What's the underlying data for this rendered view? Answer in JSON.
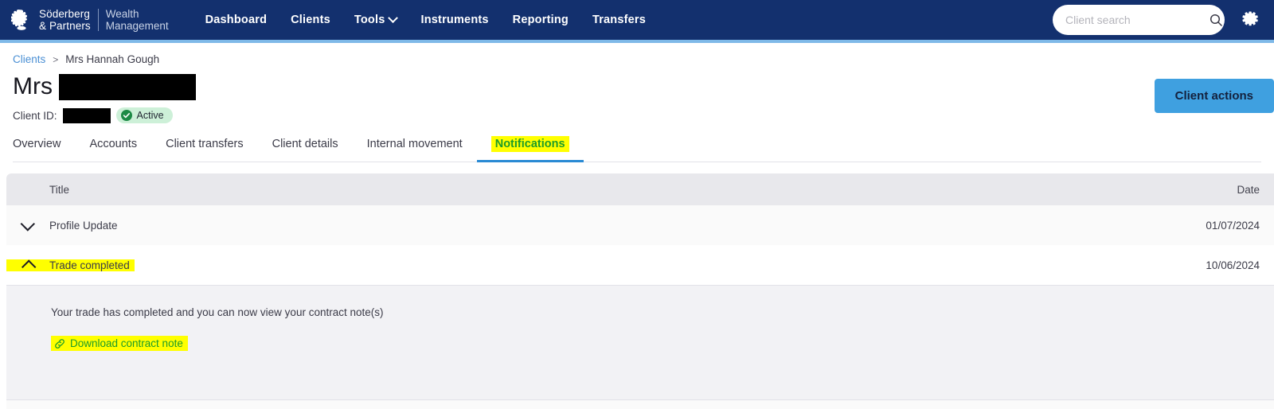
{
  "header": {
    "brand_name": "Söderberg\n& Partners",
    "brand_sub": "Wealth\nManagement",
    "nav": [
      {
        "label": "Dashboard",
        "has_caret": false
      },
      {
        "label": "Clients",
        "has_caret": false
      },
      {
        "label": "Tools",
        "has_caret": true
      },
      {
        "label": "Instruments",
        "has_caret": false
      },
      {
        "label": "Reporting",
        "has_caret": false
      },
      {
        "label": "Transfers",
        "has_caret": false
      }
    ],
    "search": {
      "placeholder": "Client search",
      "value": "",
      "icon": "search-icon"
    },
    "settings_icon": "gear-icon",
    "colors": {
      "navy": "#13306e",
      "underline": "#7fb9e8"
    }
  },
  "breadcrumb": {
    "root_label": "Clients",
    "separator": ">",
    "current_label": "Mrs Hannah Gough"
  },
  "client": {
    "title_prefix": "Mrs",
    "name_redacted": true,
    "client_id_label": "Client ID:",
    "client_id_redacted": true,
    "status_label": "Active",
    "status_color": "#cdf0d8",
    "actions_button": "Client actions",
    "actions_button_color": "#3fa0e0"
  },
  "tabs": [
    {
      "label": "Overview",
      "active": false,
      "highlighted": false
    },
    {
      "label": "Accounts",
      "active": false,
      "highlighted": false
    },
    {
      "label": "Client transfers",
      "active": false,
      "highlighted": false
    },
    {
      "label": "Client details",
      "active": false,
      "highlighted": false
    },
    {
      "label": "Internal movement",
      "active": false,
      "highlighted": false
    },
    {
      "label": "Notifications",
      "active": true,
      "highlighted": true
    }
  ],
  "table": {
    "columns": {
      "title": "Title",
      "date": "Date"
    },
    "rows": [
      {
        "title": "Profile Update",
        "date": "01/07/2024",
        "expanded": false,
        "chevron": "chevron-down-icon",
        "highlighted": false
      },
      {
        "title": "Trade completed",
        "date": "10/06/2024",
        "expanded": true,
        "chevron": "chevron-up-icon",
        "highlighted": true
      }
    ],
    "expanded_panel": {
      "body_text": "Your trade has completed and you can now view your contract note(s)",
      "link_label": "Download contract note",
      "link_icon": "link-icon",
      "link_color": "#1c9c28",
      "highlight_color": "#ffff00"
    }
  }
}
